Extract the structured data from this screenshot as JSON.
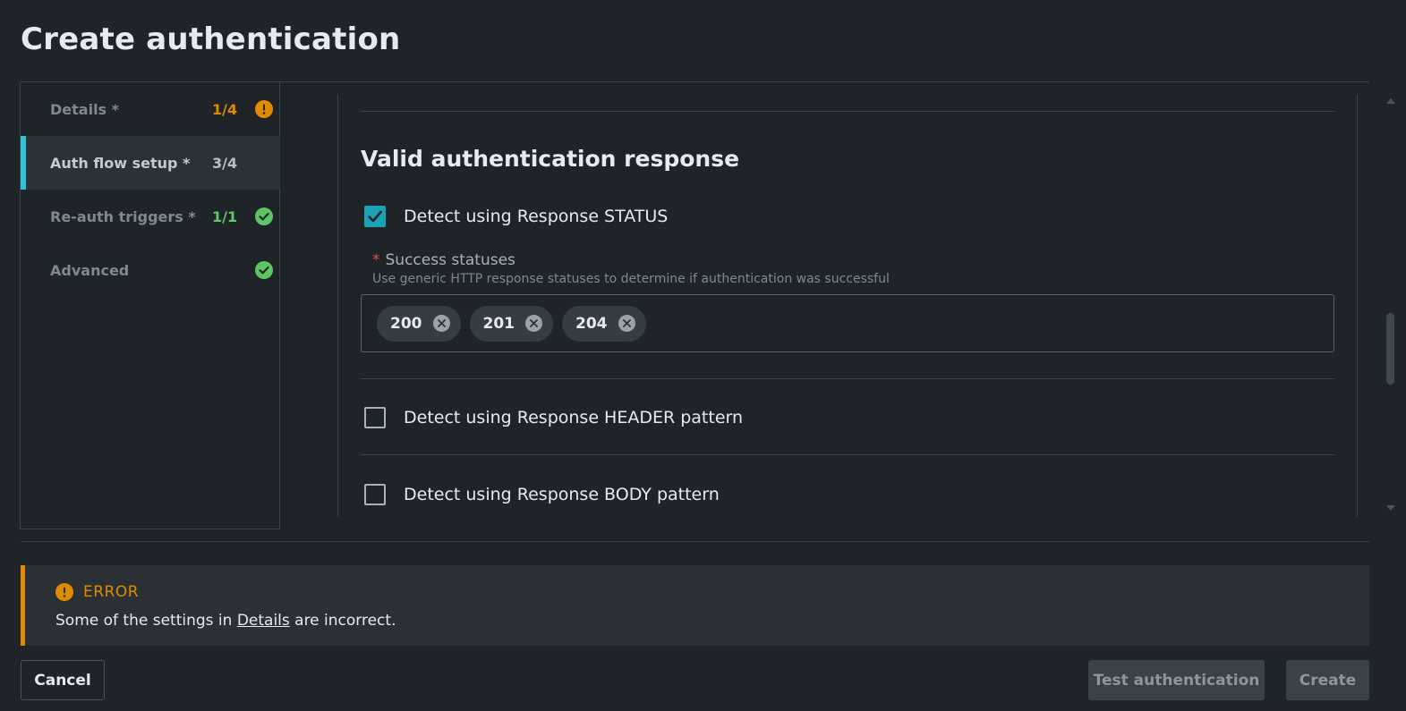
{
  "page": {
    "title": "Create authentication"
  },
  "sidebar": {
    "items": [
      {
        "label": "Details *",
        "count": "1/4",
        "status": "warning",
        "active": false
      },
      {
        "label": "Auth flow setup *",
        "count": "3/4",
        "status": "none",
        "active": true
      },
      {
        "label": "Re-auth triggers *",
        "count": "1/1",
        "status": "success",
        "active": false
      },
      {
        "label": "Advanced",
        "count": "",
        "status": "success",
        "active": false
      }
    ]
  },
  "content": {
    "section_title": "Valid authentication response",
    "status_check": {
      "label": "Detect using Response STATUS",
      "checked": true
    },
    "success_statuses": {
      "label": "Success statuses",
      "required_mark": "*",
      "help": "Use generic HTTP response statuses to determine if authentication was successful",
      "tags": [
        "200",
        "201",
        "204"
      ]
    },
    "header_check": {
      "label": "Detect using Response HEADER pattern",
      "checked": false
    },
    "body_check": {
      "label": "Detect using Response BODY pattern",
      "checked": false
    }
  },
  "error": {
    "title": "ERROR",
    "message_prefix": "Some of the settings in ",
    "message_link": "Details",
    "message_suffix": " are incorrect."
  },
  "buttons": {
    "cancel": "Cancel",
    "test": "Test authentication",
    "create": "Create"
  },
  "colors": {
    "accent": "#33c3d9",
    "warning": "#e08a00",
    "success": "#5cc667",
    "checkbox": "#1aa3b5"
  }
}
